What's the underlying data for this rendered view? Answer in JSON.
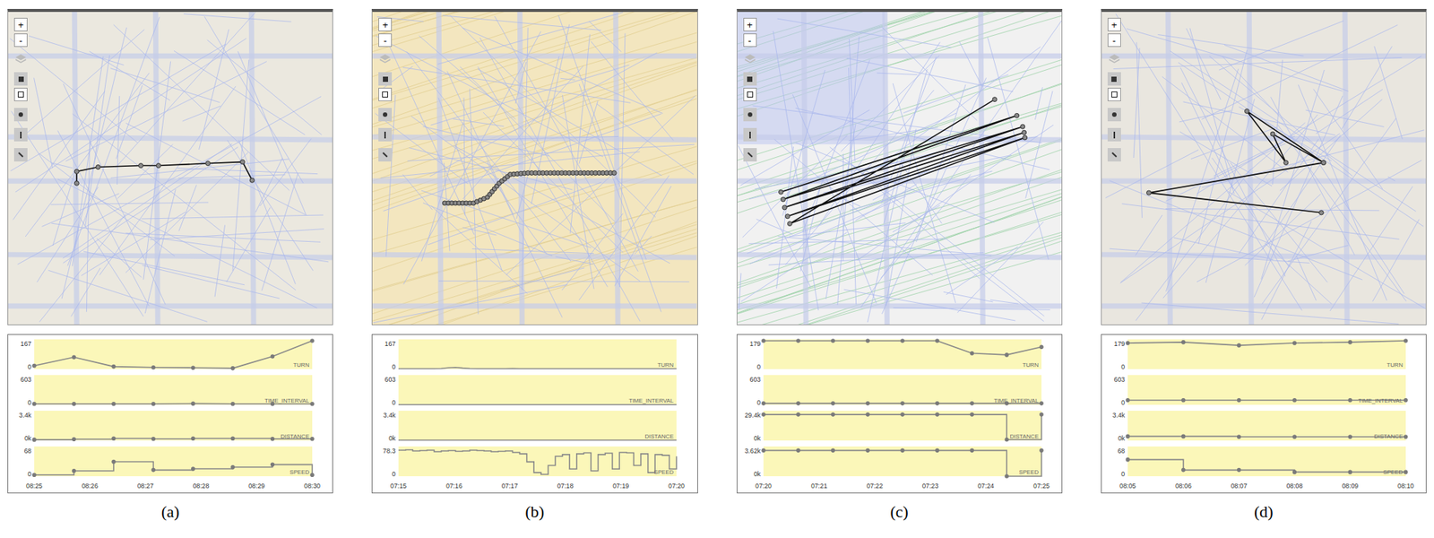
{
  "panels": [
    {
      "caption": "(a)",
      "map": {
        "controls": [
          "+",
          "-"
        ]
      },
      "chart": {
        "markers": true,
        "x_ticks": [
          "08:25",
          "08:26",
          "08:27",
          "08:28",
          "08:29",
          "08:30"
        ],
        "rows": [
          {
            "label": "TURN",
            "max": "167",
            "min": "0",
            "kind": "line",
            "values": [
              20,
              70,
              15,
              10,
              8,
              5,
              75,
              167
            ]
          },
          {
            "label": "TIME_INTERVAL",
            "max": "603",
            "min": "0",
            "kind": "line",
            "values": [
              20,
              20,
              20,
              20,
              25,
              20,
              20,
              20
            ]
          },
          {
            "label": "DISTANCE",
            "max": "3.4k",
            "min": "0k",
            "kind": "step",
            "values": [
              100,
              150,
              250,
              200,
              250,
              250,
              200,
              200
            ]
          },
          {
            "label": "SPEED",
            "max": "68",
            "min": "0",
            "kind": "step",
            "values": [
              3,
              13,
              35,
              15,
              18,
              22,
              28,
              3
            ]
          }
        ]
      }
    },
    {
      "caption": "(b)",
      "map": {
        "controls": [
          "+",
          "-"
        ]
      },
      "chart": {
        "markers": false,
        "x_ticks": [
          "07:15",
          "07:16",
          "07:17",
          "07:18",
          "07:19",
          "07:20"
        ],
        "rows": [
          {
            "label": "TURN",
            "max": "167",
            "min": "0",
            "kind": "line",
            "values": [
              2,
              2,
              2,
              2,
              2,
              2,
              3,
              8,
              10,
              6,
              3,
              2,
              2,
              2,
              2,
              2,
              3,
              2,
              2,
              2,
              2,
              2,
              2,
              2,
              2,
              2,
              2,
              2,
              2,
              2,
              2,
              2,
              2,
              2,
              2,
              2,
              2,
              2,
              2,
              2
            ]
          },
          {
            "label": "TIME_INTERVAL",
            "max": "603",
            "min": "0",
            "kind": "line",
            "values": [
              3,
              3,
              3,
              3,
              3,
              3,
              3,
              3,
              3,
              3,
              3,
              3,
              3,
              3,
              3,
              3,
              3,
              3,
              3,
              3,
              3,
              3,
              3,
              3,
              3,
              3,
              3,
              3,
              3,
              3,
              3,
              3,
              3,
              3,
              3,
              3,
              3,
              3,
              3,
              3
            ]
          },
          {
            "label": "DISTANCE",
            "max": "3.4k",
            "min": "0k",
            "kind": "step",
            "values": [
              40,
              40,
              40,
              40,
              40,
              40,
              40,
              40,
              40,
              40,
              40,
              40,
              40,
              40,
              40,
              40,
              40,
              40,
              40,
              40,
              40,
              40,
              40,
              40,
              40,
              40,
              40,
              40,
              40,
              40,
              40,
              40,
              40,
              40,
              40,
              40,
              40,
              40,
              40,
              40
            ]
          },
          {
            "label": "SPEED",
            "max": "78.3",
            "min": "0",
            "kind": "step",
            "values": [
              72,
              73,
              70,
              71,
              72,
              68,
              70,
              71,
              69,
              70,
              72,
              71,
              70,
              68,
              69,
              70,
              66,
              62,
              40,
              10,
              5,
              30,
              55,
              60,
              20,
              62,
              65,
              15,
              60,
              64,
              20,
              66,
              65,
              30,
              62,
              10,
              60,
              58,
              20,
              55
            ]
          }
        ]
      }
    },
    {
      "caption": "(c)",
      "map": {
        "controls": [
          "+",
          "-"
        ]
      },
      "chart": {
        "markers": true,
        "x_ticks": [
          "07:20",
          "07:21",
          "07:22",
          "07:23",
          "07:24",
          "07:25"
        ],
        "rows": [
          {
            "label": "TURN",
            "max": "179",
            "min": "0",
            "kind": "line",
            "values": [
              179,
              179,
              179,
              179,
              179,
              179,
              100,
              90,
              140
            ]
          },
          {
            "label": "TIME_INTERVAL",
            "max": "603",
            "min": "0",
            "kind": "line",
            "values": [
              30,
              30,
              30,
              30,
              30,
              30,
              30,
              30,
              30
            ]
          },
          {
            "label": "DISTANCE",
            "max": "29.4k",
            "min": "0k",
            "kind": "step",
            "values": [
              27000,
              27000,
              27000,
              27000,
              27000,
              27000,
              27000,
              1000,
              27000
            ]
          },
          {
            "label": "SPEED",
            "max": "3.62k",
            "min": "0k",
            "kind": "step",
            "values": [
              3300,
              3300,
              3300,
              3300,
              3300,
              3300,
              3300,
              0,
              3300
            ]
          }
        ]
      }
    },
    {
      "caption": "(d)",
      "map": {
        "controls": [
          "+",
          "-"
        ]
      },
      "chart": {
        "markers": true,
        "x_ticks": [
          "08:05",
          "08:06",
          "08:07",
          "08:08",
          "08:09",
          "08:10"
        ],
        "rows": [
          {
            "label": "TURN",
            "max": "179",
            "min": "0",
            "kind": "line",
            "values": [
              165,
              170,
              150,
              165,
              170,
              179
            ]
          },
          {
            "label": "TIME_INTERVAL",
            "max": "603",
            "min": "0",
            "kind": "line",
            "values": [
              100,
              100,
              100,
              100,
              100,
              100
            ]
          },
          {
            "label": "DISTANCE",
            "max": "3.4k",
            "min": "0k",
            "kind": "step",
            "values": [
              500,
              500,
              450,
              450,
              450,
              450
            ]
          },
          {
            "label": "SPEED",
            "max": "68",
            "min": "0",
            "kind": "step",
            "values": [
              40,
              15,
              15,
              10,
              10,
              10
            ]
          }
        ]
      }
    }
  ]
}
